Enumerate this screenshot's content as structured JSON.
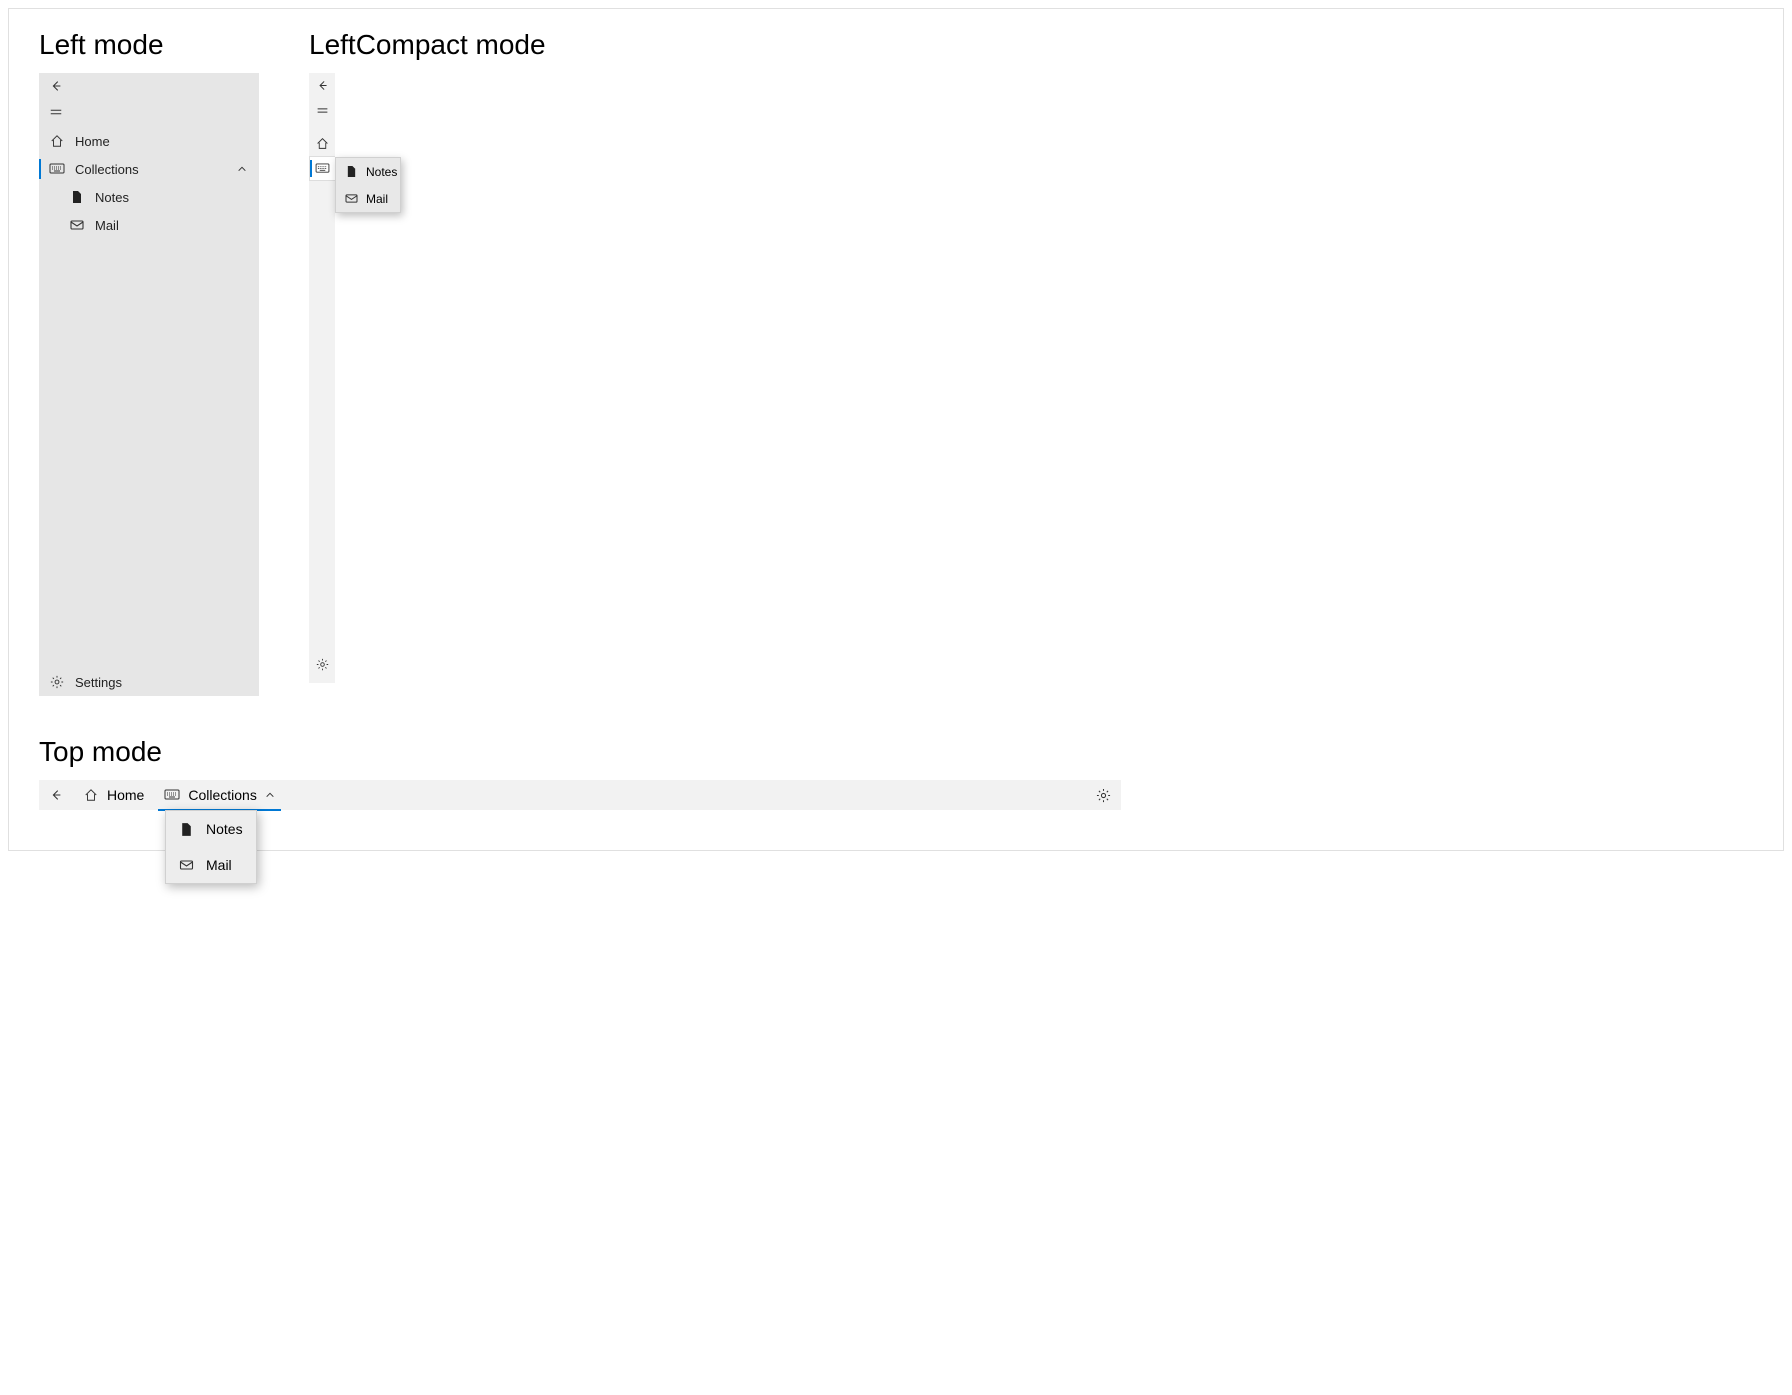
{
  "left_mode": {
    "title": "Left mode",
    "home": "Home",
    "collections": "Collections",
    "notes": "Notes",
    "mail": "Mail",
    "settings": "Settings"
  },
  "left_compact_mode": {
    "title": "LeftCompact mode",
    "flyout": {
      "notes": "Notes",
      "mail": "Mail"
    }
  },
  "top_mode": {
    "title": "Top mode",
    "home": "Home",
    "collections": "Collections",
    "flyout": {
      "notes": "Notes",
      "mail": "Mail"
    }
  }
}
